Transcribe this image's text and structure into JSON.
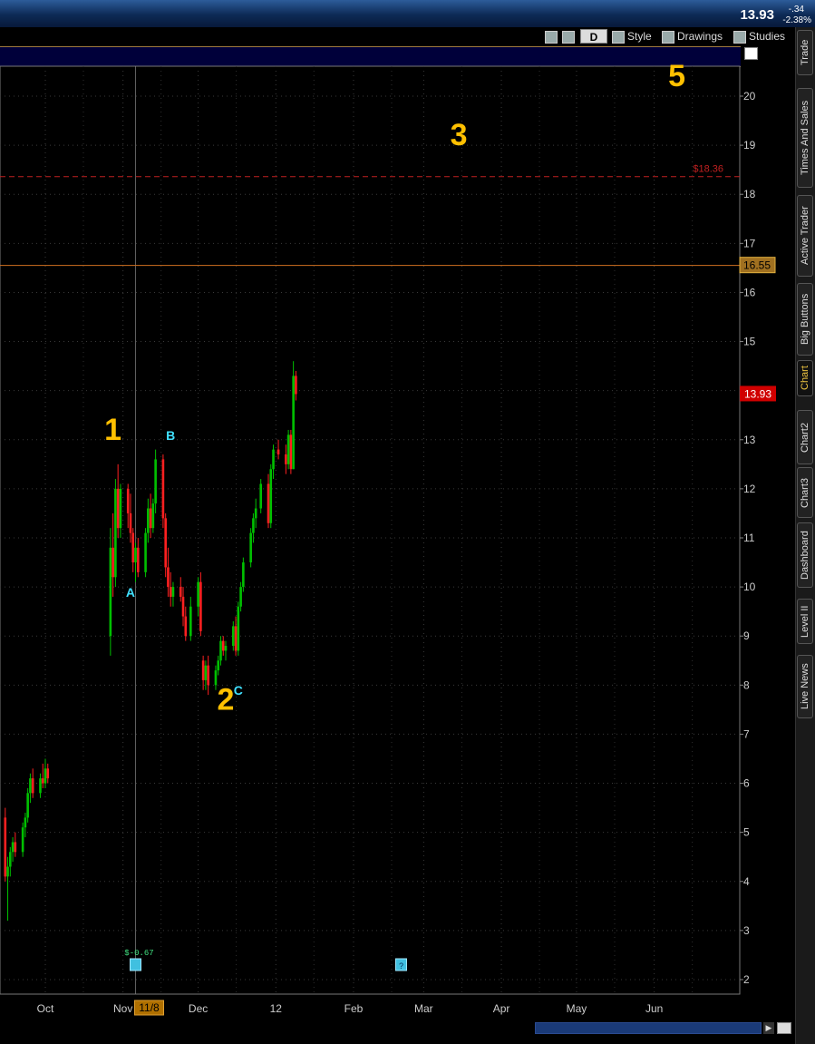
{
  "header": {
    "last": "13.93",
    "change": "-.34",
    "change_pct": "-2.38%"
  },
  "toolbar": {
    "period": "D",
    "style": "Style",
    "drawings": "Drawings",
    "studies": "Studies"
  },
  "side_tabs": [
    "Trade",
    "Times And Sales",
    "Active Trader",
    "Big Buttons",
    "Chart",
    "Chart2",
    "Chart3",
    "Dashboard",
    "Level II",
    "Live News"
  ],
  "active_tab": "Chart",
  "colors": {
    "up": "#00c000",
    "down": "#ff2020",
    "wave_label": "#ffc000",
    "abc_label": "#40e0ff",
    "level": "#d07020",
    "price_box": "#d00000"
  },
  "chart_data": {
    "type": "candlestick",
    "title": "",
    "ylim": [
      1.5,
      21
    ],
    "x_tick_labels": [
      "Oct",
      "Nov",
      "Dec",
      "12",
      "Feb",
      "Mar",
      "Apr",
      "May",
      "Jun"
    ],
    "cursor_date_label": "11/8",
    "y_ticks": [
      2,
      3,
      4,
      5,
      6,
      7,
      8,
      9,
      10,
      11,
      12,
      13,
      14,
      15,
      16,
      17,
      18,
      19,
      20
    ],
    "lines": [
      {
        "label": "$18.36",
        "value": 18.36,
        "style": "dashed",
        "color": "#c02020"
      },
      {
        "label": "16.55",
        "value": 16.55,
        "style": "solid",
        "color": "#d07020"
      }
    ],
    "last_price_label": "13.93",
    "last_price": 13.93,
    "wave_labels": [
      {
        "text": "1",
        "date": "Oct 28",
        "price": 13.0
      },
      {
        "text": "2",
        "date": "Dec 12",
        "price": 7.5
      },
      {
        "text": "3",
        "date": "Mar 15",
        "price": 19.0
      },
      {
        "text": "5",
        "date": "Jun 10",
        "price": 20.2
      }
    ],
    "abc_labels": [
      {
        "text": "A",
        "date": "Nov 4",
        "price": 9.8
      },
      {
        "text": "B",
        "date": "Nov 20",
        "price": 13.0
      },
      {
        "text": "C",
        "date": "Dec 17",
        "price": 7.8
      }
    ],
    "event_markers": [
      {
        "text": "$-0.67",
        "date": "Nov 6",
        "kind": "earnings"
      },
      {
        "text": "?",
        "date": "Feb 20",
        "kind": "unknown"
      }
    ],
    "candles": [
      {
        "date": "Sep 1",
        "o": 7.6,
        "h": 7.8,
        "l": 7.3,
        "c": 7.4
      },
      {
        "date": "Sep 2",
        "o": 7.4,
        "h": 7.6,
        "l": 7.2,
        "c": 7.5
      },
      {
        "date": "Sep 3",
        "o": 7.5,
        "h": 7.6,
        "l": 7.0,
        "c": 7.2
      },
      {
        "date": "Sep 4",
        "o": 7.2,
        "h": 7.3,
        "l": 6.5,
        "c": 6.7
      },
      {
        "date": "Sep 5",
        "o": 6.7,
        "h": 6.8,
        "l": 5.8,
        "c": 6.0
      },
      {
        "date": "Sep 8",
        "o": 6.0,
        "h": 6.1,
        "l": 5.0,
        "c": 5.2
      },
      {
        "date": "Sep 9",
        "o": 5.2,
        "h": 5.6,
        "l": 4.8,
        "c": 5.4
      },
      {
        "date": "Sep 10",
        "o": 5.4,
        "h": 5.8,
        "l": 5.2,
        "c": 5.7
      },
      {
        "date": "Sep 11",
        "o": 5.7,
        "h": 5.9,
        "l": 5.0,
        "c": 5.1
      },
      {
        "date": "Sep 12",
        "o": 5.1,
        "h": 5.4,
        "l": 4.9,
        "c": 5.3
      },
      {
        "date": "Sep 15",
        "o": 5.3,
        "h": 5.5,
        "l": 4.0,
        "c": 4.1
      },
      {
        "date": "Sep 16",
        "o": 4.1,
        "h": 4.5,
        "l": 3.2,
        "c": 4.3
      },
      {
        "date": "Sep 17",
        "o": 4.3,
        "h": 4.7,
        "l": 4.1,
        "c": 4.6
      },
      {
        "date": "Sep 18",
        "o": 4.6,
        "h": 4.9,
        "l": 4.4,
        "c": 4.8
      },
      {
        "date": "Sep 19",
        "o": 4.8,
        "h": 5.0,
        "l": 4.5,
        "c": 4.6
      },
      {
        "date": "Sep 22",
        "o": 4.6,
        "h": 5.2,
        "l": 4.5,
        "c": 5.1
      },
      {
        "date": "Sep 23",
        "o": 5.1,
        "h": 5.4,
        "l": 4.9,
        "c": 5.3
      },
      {
        "date": "Sep 24",
        "o": 5.3,
        "h": 5.9,
        "l": 5.2,
        "c": 5.8
      },
      {
        "date": "Sep 25",
        "o": 5.8,
        "h": 6.2,
        "l": 5.6,
        "c": 6.1
      },
      {
        "date": "Sep 26",
        "o": 6.1,
        "h": 6.3,
        "l": 5.7,
        "c": 5.8
      },
      {
        "date": "Sep 29",
        "o": 5.8,
        "h": 6.2,
        "l": 5.7,
        "c": 6.1
      },
      {
        "date": "Sep 30",
        "o": 6.1,
        "h": 6.4,
        "l": 5.9,
        "c": 6.0
      },
      {
        "date": "Oct 1",
        "o": 6.0,
        "h": 6.5,
        "l": 5.9,
        "c": 6.3
      },
      {
        "date": "Oct 2",
        "o": 6.3,
        "h": 6.4,
        "l": 6.0,
        "c": 6.1
      },
      {
        "date": "Oct 27",
        "o": 9.0,
        "h": 11.2,
        "l": 8.6,
        "c": 10.8
      },
      {
        "date": "Oct 28",
        "o": 10.8,
        "h": 11.5,
        "l": 9.8,
        "c": 10.2
      },
      {
        "date": "Oct 29",
        "o": 10.2,
        "h": 12.2,
        "l": 10.0,
        "c": 12.0
      },
      {
        "date": "Oct 30",
        "o": 12.0,
        "h": 12.5,
        "l": 11.0,
        "c": 11.2
      },
      {
        "date": "Oct 31",
        "o": 11.2,
        "h": 12.1,
        "l": 11.0,
        "c": 12.0
      },
      {
        "date": "Nov 3",
        "o": 12.0,
        "h": 12.1,
        "l": 11.2,
        "c": 11.5
      },
      {
        "date": "Nov 4",
        "o": 11.5,
        "h": 11.9,
        "l": 10.9,
        "c": 11.1
      },
      {
        "date": "Nov 5",
        "o": 11.1,
        "h": 11.2,
        "l": 10.3,
        "c": 10.5
      },
      {
        "date": "Nov 6",
        "o": 10.5,
        "h": 10.9,
        "l": 10.1,
        "c": 10.8
      },
      {
        "date": "Nov 7",
        "o": 10.8,
        "h": 11.0,
        "l": 10.2,
        "c": 10.3
      },
      {
        "date": "Nov 10",
        "o": 10.3,
        "h": 11.2,
        "l": 10.2,
        "c": 11.1
      },
      {
        "date": "Nov 11",
        "o": 11.1,
        "h": 11.8,
        "l": 10.9,
        "c": 11.6
      },
      {
        "date": "Nov 12",
        "o": 11.6,
        "h": 11.9,
        "l": 11.0,
        "c": 11.2
      },
      {
        "date": "Nov 13",
        "o": 11.2,
        "h": 11.8,
        "l": 11.1,
        "c": 11.7
      },
      {
        "date": "Nov 14",
        "o": 11.7,
        "h": 12.8,
        "l": 11.5,
        "c": 12.6
      },
      {
        "date": "Nov 17",
        "o": 12.6,
        "h": 12.7,
        "l": 11.2,
        "c": 11.4
      },
      {
        "date": "Nov 18",
        "o": 11.4,
        "h": 11.5,
        "l": 10.2,
        "c": 10.4
      },
      {
        "date": "Nov 19",
        "o": 10.4,
        "h": 10.8,
        "l": 9.8,
        "c": 10.0
      },
      {
        "date": "Nov 20",
        "o": 10.0,
        "h": 10.3,
        "l": 9.6,
        "c": 9.8
      },
      {
        "date": "Nov 21",
        "o": 9.8,
        "h": 10.1,
        "l": 9.6,
        "c": 10.0
      },
      {
        "date": "Nov 24",
        "o": 10.0,
        "h": 10.2,
        "l": 9.7,
        "c": 9.8
      },
      {
        "date": "Nov 25",
        "o": 9.8,
        "h": 10.0,
        "l": 9.2,
        "c": 9.4
      },
      {
        "date": "Nov 26",
        "o": 9.4,
        "h": 9.6,
        "l": 8.9,
        "c": 9.0
      },
      {
        "date": "Nov 28",
        "o": 9.0,
        "h": 9.8,
        "l": 8.9,
        "c": 9.6
      },
      {
        "date": "Dec 1",
        "o": 9.6,
        "h": 10.2,
        "l": 9.4,
        "c": 10.1
      },
      {
        "date": "Dec 2",
        "o": 10.1,
        "h": 10.3,
        "l": 9.0,
        "c": 9.1
      },
      {
        "date": "Dec 3",
        "o": 8.5,
        "h": 8.6,
        "l": 7.9,
        "c": 8.1
      },
      {
        "date": "Dec 4",
        "o": 8.1,
        "h": 8.5,
        "l": 7.9,
        "c": 8.4
      },
      {
        "date": "Dec 5",
        "o": 8.4,
        "h": 8.6,
        "l": 7.8,
        "c": 8.0
      },
      {
        "date": "Dec 8",
        "o": 8.0,
        "h": 8.4,
        "l": 7.9,
        "c": 8.3
      },
      {
        "date": "Dec 9",
        "o": 8.3,
        "h": 8.6,
        "l": 8.2,
        "c": 8.5
      },
      {
        "date": "Dec 10",
        "o": 8.5,
        "h": 9.0,
        "l": 8.4,
        "c": 8.9
      },
      {
        "date": "Dec 11",
        "o": 8.9,
        "h": 9.0,
        "l": 8.6,
        "c": 8.7
      },
      {
        "date": "Dec 12",
        "o": 8.7,
        "h": 8.9,
        "l": 8.5,
        "c": 8.8
      },
      {
        "date": "Dec 15",
        "o": 8.8,
        "h": 9.3,
        "l": 8.7,
        "c": 9.2
      },
      {
        "date": "Dec 16",
        "o": 9.2,
        "h": 9.4,
        "l": 8.6,
        "c": 8.7
      },
      {
        "date": "Dec 17",
        "o": 8.7,
        "h": 9.7,
        "l": 8.6,
        "c": 9.6
      },
      {
        "date": "Dec 18",
        "o": 9.6,
        "h": 10.1,
        "l": 9.5,
        "c": 10.0
      },
      {
        "date": "Dec 19",
        "o": 10.0,
        "h": 10.6,
        "l": 9.9,
        "c": 10.5
      },
      {
        "date": "Dec 22",
        "o": 10.5,
        "h": 11.2,
        "l": 10.4,
        "c": 11.1
      },
      {
        "date": "Dec 23",
        "o": 11.1,
        "h": 11.5,
        "l": 10.9,
        "c": 11.4
      },
      {
        "date": "Dec 24",
        "o": 11.4,
        "h": 11.8,
        "l": 11.2,
        "c": 11.6
      },
      {
        "date": "Dec 26",
        "o": 11.6,
        "h": 12.2,
        "l": 11.5,
        "c": 12.1
      },
      {
        "date": "Dec 29",
        "o": 12.1,
        "h": 12.3,
        "l": 11.2,
        "c": 11.3
      },
      {
        "date": "Dec 30",
        "o": 11.3,
        "h": 12.5,
        "l": 11.2,
        "c": 12.4
      },
      {
        "date": "Dec 31",
        "o": 12.4,
        "h": 12.9,
        "l": 12.2,
        "c": 12.8
      },
      {
        "date": "Jan 2",
        "o": 12.8,
        "h": 13.0,
        "l": 12.6,
        "c": 12.7
      },
      {
        "date": "Jan 5",
        "o": 12.7,
        "h": 12.9,
        "l": 12.3,
        "c": 12.5
      },
      {
        "date": "Jan 6",
        "o": 12.5,
        "h": 13.2,
        "l": 12.4,
        "c": 13.1
      },
      {
        "date": "Jan 7",
        "o": 13.1,
        "h": 13.2,
        "l": 12.3,
        "c": 12.4
      },
      {
        "date": "Jan 8",
        "o": 12.4,
        "h": 14.6,
        "l": 12.4,
        "c": 14.3
      },
      {
        "date": "Jan 9",
        "o": 14.3,
        "h": 14.4,
        "l": 13.8,
        "c": 13.93
      }
    ]
  }
}
